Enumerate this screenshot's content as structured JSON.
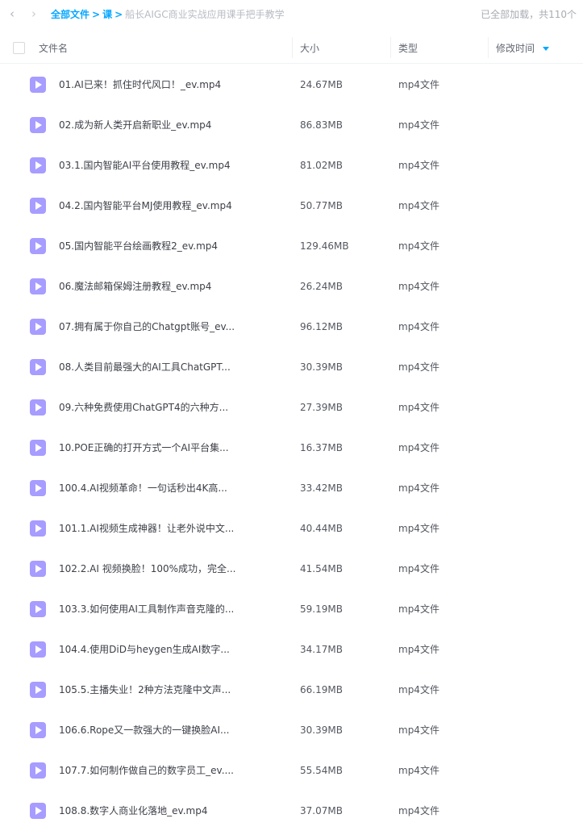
{
  "topbar": {
    "back_icon": "chevron-left-icon",
    "forward_icon": "chevron-right-icon",
    "breadcrumb_root": "全部文件",
    "breadcrumb_mid": "课",
    "breadcrumb_separator": ">",
    "breadcrumb_current": "船长AIGC商业实战应用课手把手教学",
    "loaded_text": "已全部加载，共110个"
  },
  "header": {
    "col_name": "文件名",
    "col_size": "大小",
    "col_type": "类型",
    "col_modified": "修改时间",
    "sort_icon": "sort-down-icon",
    "accent_color": "#06a7ff"
  },
  "file_icon": "video-file-icon",
  "files": [
    {
      "name": "01.AI已来！抓住时代风口！_ev.mp4",
      "size": "24.67MB",
      "type": "mp4文件"
    },
    {
      "name": "02.成为新人类开启新职业_ev.mp4",
      "size": "86.83MB",
      "type": "mp4文件"
    },
    {
      "name": "03.1.国内智能AI平台使用教程_ev.mp4",
      "size": "81.02MB",
      "type": "mp4文件"
    },
    {
      "name": "04.2.国内智能平台MJ使用教程_ev.mp4",
      "size": "50.77MB",
      "type": "mp4文件"
    },
    {
      "name": "05.国内智能平台绘画教程2_ev.mp4",
      "size": "129.46MB",
      "type": "mp4文件"
    },
    {
      "name": "06.魔法邮箱保姆注册教程_ev.mp4",
      "size": "26.24MB",
      "type": "mp4文件"
    },
    {
      "name": "07.拥有属于你自己的Chatgpt账号_ev...",
      "size": "96.12MB",
      "type": "mp4文件"
    },
    {
      "name": "08.人类目前最强大的AI工具ChatGPT...",
      "size": "30.39MB",
      "type": "mp4文件"
    },
    {
      "name": "09.六种免费使用ChatGPT4的六种方...",
      "size": "27.39MB",
      "type": "mp4文件"
    },
    {
      "name": "10.POE正确的打开方式一个AI平台集...",
      "size": "16.37MB",
      "type": "mp4文件"
    },
    {
      "name": "100.4.AI视频革命！一句话秒出4K高...",
      "size": "33.42MB",
      "type": "mp4文件"
    },
    {
      "name": "101.1.AI视频生成神器！让老外说中文...",
      "size": "40.44MB",
      "type": "mp4文件"
    },
    {
      "name": "102.2.AI 视频换脸！100%成功，完全...",
      "size": "41.54MB",
      "type": "mp4文件"
    },
    {
      "name": "103.3.如何使用AI工具制作声音克隆的...",
      "size": "59.19MB",
      "type": "mp4文件"
    },
    {
      "name": "104.4.使用DiD与heygen生成AI数字...",
      "size": "34.17MB",
      "type": "mp4文件"
    },
    {
      "name": "105.5.主播失业！2种方法克隆中文声...",
      "size": "66.19MB",
      "type": "mp4文件"
    },
    {
      "name": "106.6.Rope又一款强大的一键换脸AI...",
      "size": "30.39MB",
      "type": "mp4文件"
    },
    {
      "name": "107.7.如何制作做自己的数字员工_ev....",
      "size": "55.54MB",
      "type": "mp4文件"
    },
    {
      "name": "108.8.数字人商业化落地_ev.mp4",
      "size": "37.07MB",
      "type": "mp4文件"
    }
  ]
}
